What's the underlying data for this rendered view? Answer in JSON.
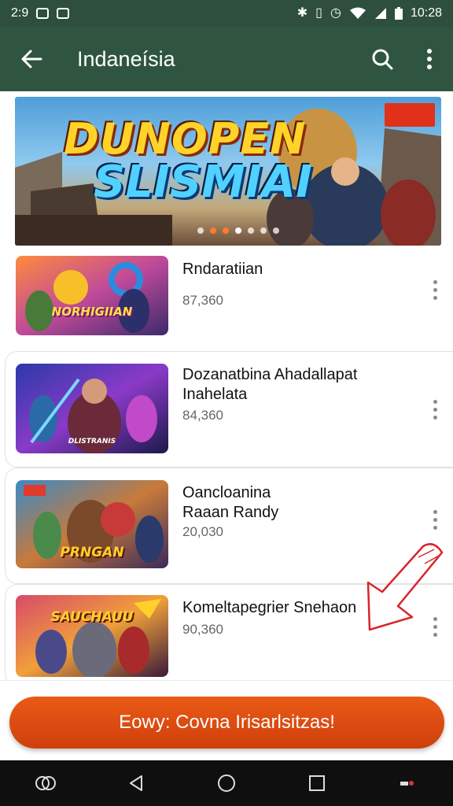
{
  "status_bar": {
    "time": "2:9",
    "clock": "10:28",
    "icons": [
      "whatsapp-icon",
      "image-icon",
      "bluetooth-icon",
      "vibrate-icon",
      "alarm-icon",
      "wifi-icon",
      "signal-icon",
      "battery-icon"
    ]
  },
  "app_bar": {
    "title": "Indaneísia",
    "back_icon": "arrow-left-icon",
    "search_icon": "search-icon",
    "menu_icon": "more-vertical-icon",
    "background": "#2f5541"
  },
  "banner": {
    "title_line1": "DUNOPEN",
    "title_line2": "SLISMIAI",
    "badge": "",
    "carousel_count": 7,
    "carousel_active": 3
  },
  "items": [
    {
      "title": "Rndaratiian",
      "value": "87,360",
      "thumb_label": "NORHIGIIAN"
    },
    {
      "title": "Dozanatbina Ahadallapat\nInahelata",
      "value": "84,360",
      "thumb_label": "DLISTRANIS"
    },
    {
      "title": "Oancloanina\nRaaan Randy",
      "value": "20,030",
      "thumb_label": "PRNGAN"
    },
    {
      "title": "Komeltapegrier Snehaon",
      "value": "90,360",
      "thumb_label": "SAUCHAUU"
    }
  ],
  "cta": {
    "label": "Eowy: Covna Irisarlsitzas!",
    "color": "#dc4a10"
  },
  "nav_bar": {
    "icons": [
      "assistant-icon",
      "back-triangle-icon",
      "home-circle-icon",
      "recents-square-icon",
      "notification-icon"
    ]
  }
}
